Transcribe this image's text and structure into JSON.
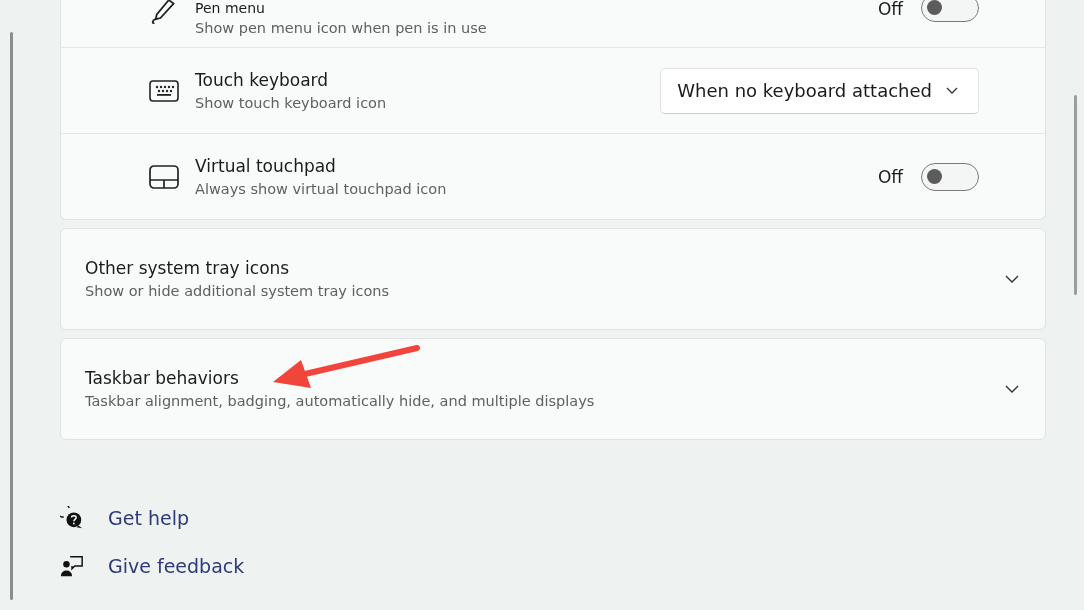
{
  "device_rows": [
    {
      "kind": "toggle",
      "title": "Pen menu",
      "subtitle": "Show pen menu icon when pen is in use",
      "state_label": "Off",
      "on": false
    },
    {
      "kind": "dropdown",
      "title": "Touch keyboard",
      "subtitle": "Show touch keyboard icon",
      "value": "When no keyboard attached"
    },
    {
      "kind": "toggle",
      "title": "Virtual touchpad",
      "subtitle": "Always show virtual touchpad icon",
      "state_label": "Off",
      "on": false
    }
  ],
  "sections": [
    {
      "title": "Other system tray icons",
      "subtitle": "Show or hide additional system tray icons",
      "expanded": false
    },
    {
      "title": "Taskbar behaviors",
      "subtitle": "Taskbar alignment, badging, automatically hide, and multiple displays",
      "expanded": false
    }
  ],
  "links": [
    {
      "kind": "help",
      "label": "Get help"
    },
    {
      "kind": "feedback",
      "label": "Give feedback"
    }
  ]
}
